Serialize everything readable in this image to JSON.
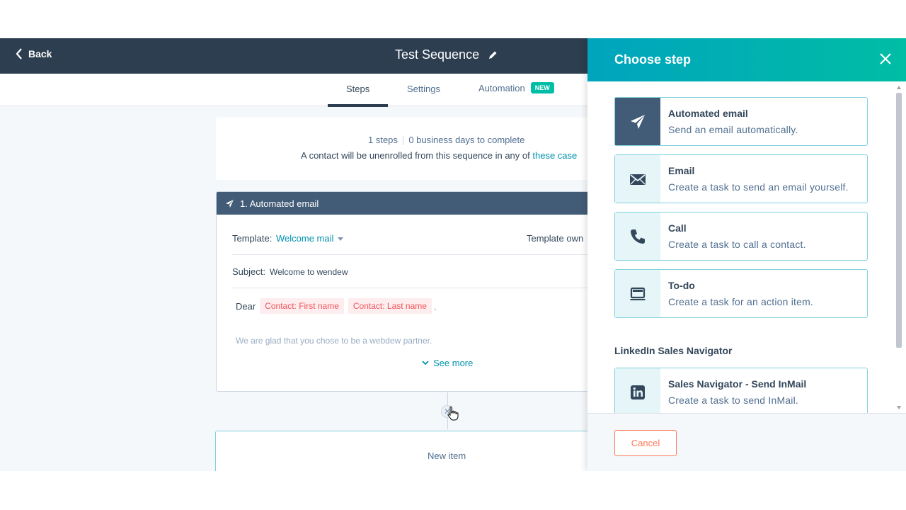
{
  "header": {
    "back_label": "Back",
    "sequence_title": "Test Sequence"
  },
  "tabs": [
    {
      "label": "Steps",
      "active": true
    },
    {
      "label": "Settings",
      "active": false
    },
    {
      "label": "Automation",
      "active": false,
      "badge": "NEW"
    }
  ],
  "summary": {
    "steps_count": "1 steps",
    "days": "0 business days to complete",
    "unenroll_text": "A contact will be unenrolled from this sequence in any of",
    "unenroll_link": "these case"
  },
  "step": {
    "title": "1. Automated email",
    "template_label": "Template:",
    "template_value": "Welcome mail",
    "owner_label": "Template own",
    "subject_label": "Subject:",
    "subject_value": "Welcome to wendew",
    "dear_label": "Dear",
    "token_first": "Contact: First name",
    "token_last": "Contact: Last name",
    "dear_end": ",",
    "body_preview": "We are glad that you chose to be a webdew partner.",
    "see_more": "See more"
  },
  "new_item": {
    "label": "New item"
  },
  "panel": {
    "title": "Choose step",
    "options": [
      {
        "title": "Automated email",
        "description": "Send an email automatically.",
        "icon": "paper-plane-icon",
        "active": true
      },
      {
        "title": "Email",
        "description": "Create a task to send an email yourself.",
        "icon": "envelope-icon",
        "active": false
      },
      {
        "title": "Call",
        "description": "Create a task to call a contact.",
        "icon": "phone-icon",
        "active": false
      },
      {
        "title": "To-do",
        "description": "Create a task for an action item.",
        "icon": "laptop-icon",
        "active": false
      }
    ],
    "section_label": "LinkedIn Sales Navigator",
    "linkedin_option": {
      "title": "Sales Navigator - Send InMail",
      "description": "Create a task to send InMail.",
      "icon": "linkedin-icon"
    },
    "cancel_label": "Cancel"
  },
  "colors": {
    "topbar": "#2d3e50",
    "panel_gradient_start": "#00a4bd",
    "panel_gradient_end": "#00bda5",
    "link": "#0091ae",
    "cancel": "#ff7a59",
    "badge": "#00bda5"
  }
}
